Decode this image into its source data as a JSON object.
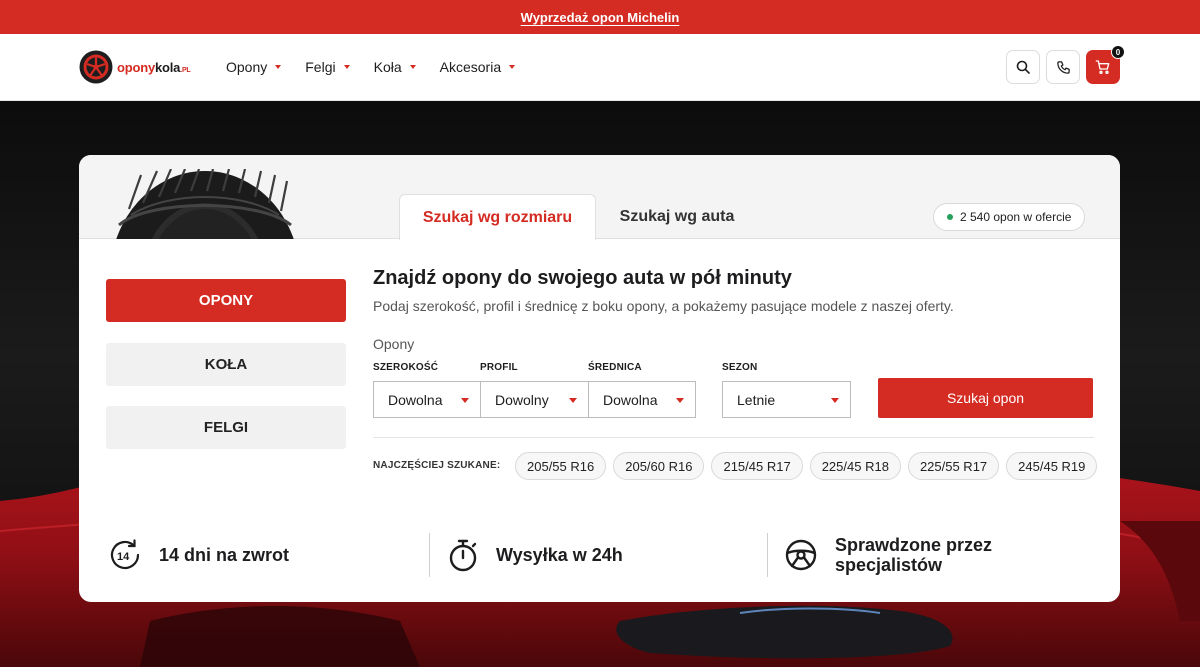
{
  "promo": {
    "link_text": "Wyprzedaż opon Michelin"
  },
  "header": {
    "logo": {
      "part1": "opony",
      "part2": "kola",
      "part3": ".PL"
    },
    "nav": [
      {
        "label": "Opony"
      },
      {
        "label": "Felgi"
      },
      {
        "label": "Koła"
      },
      {
        "label": "Akcesoria"
      }
    ],
    "cart_count": "0",
    "icons": {
      "search": "search-icon",
      "phone": "phone-icon",
      "cart": "cart-icon"
    }
  },
  "card": {
    "tabs": [
      {
        "label": "Szukaj wg rozmiaru",
        "active": true
      },
      {
        "label": "Szukaj wg auta",
        "active": false
      }
    ],
    "offer_badge": "2 540 opon w ofercie",
    "categories": [
      {
        "label": "OPONY",
        "active": true
      },
      {
        "label": "KOŁA",
        "active": false
      },
      {
        "label": "FELGI",
        "active": false
      }
    ],
    "form": {
      "title": "Znajdź opony do swojego auta w pół minuty",
      "subtitle": "Podaj szerokość, profil i średnicę z boku opony, a pokażemy pasujące modele z naszej oferty.",
      "group_label": "Opony",
      "fields": [
        {
          "label": "SZEROKOŚĆ",
          "value": "Dowolna"
        },
        {
          "label": "PROFIL",
          "value": "Dowolny"
        },
        {
          "label": "ŚREDNICA",
          "value": "Dowolna"
        },
        {
          "label": "SEZON",
          "value": "Letnie"
        }
      ],
      "submit_label": "Szukaj opon"
    },
    "popular": {
      "label": "NAJCZĘŚCIEJ SZUKANE:",
      "sizes": [
        "205/55 R16",
        "205/60 R16",
        "215/45 R17",
        "225/45 R18",
        "225/55 R17",
        "245/45 R19"
      ]
    },
    "features": [
      {
        "icon": "fourteen-days-return-icon",
        "text_line1": "14 dni na zwrot",
        "text_line2": ""
      },
      {
        "icon": "stopwatch-icon",
        "text_line1": "Wysyłka w 24h",
        "text_line2": ""
      },
      {
        "icon": "steering-wheel-icon",
        "text_line1": "Sprawdzone przez",
        "text_line2": "specjalistów"
      }
    ]
  },
  "colors": {
    "accent": "#d42b22",
    "dark": "#1d1d1f",
    "success": "#24a05a",
    "muted_bg": "#f4f4f4"
  }
}
